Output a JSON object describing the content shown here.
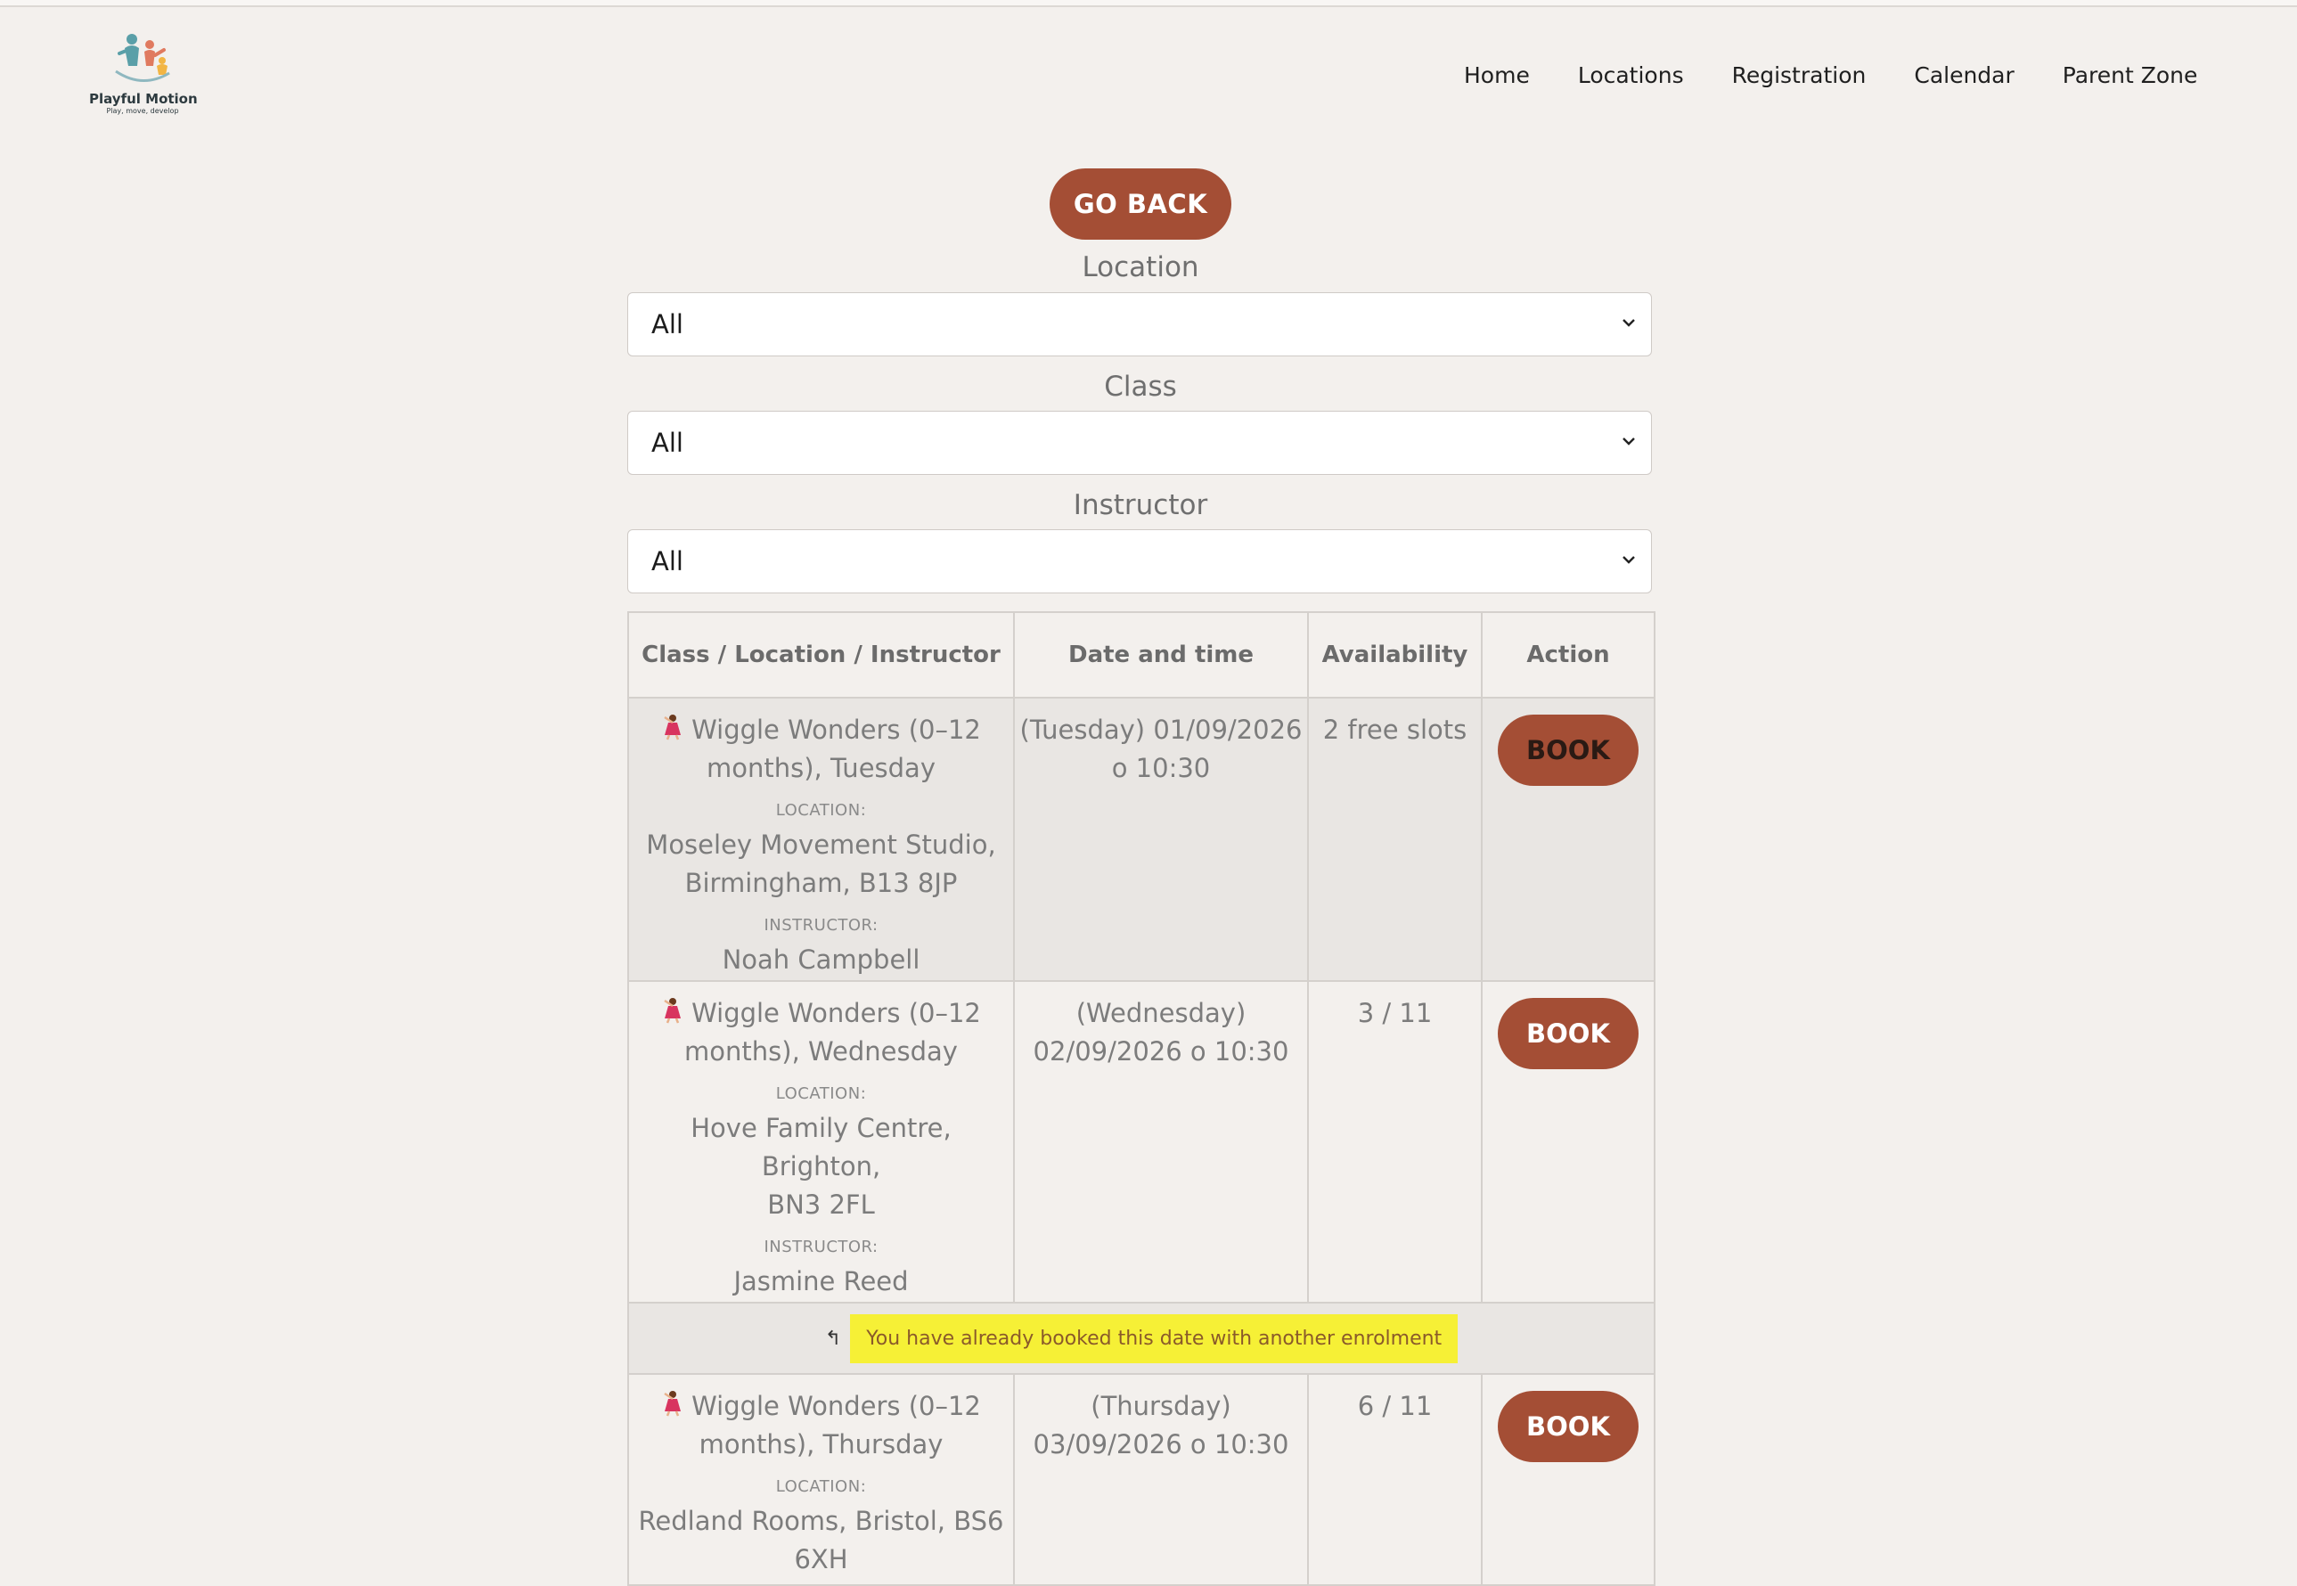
{
  "brand": {
    "name": "Playful Motion",
    "tagline": "Play, move, develop"
  },
  "nav": [
    "Home",
    "Locations",
    "Registration",
    "Calendar",
    "Parent Zone"
  ],
  "go_back": "GO BACK",
  "filters": {
    "location": {
      "label": "Location",
      "value": "All"
    },
    "class": {
      "label": "Class",
      "value": "All"
    },
    "instructor": {
      "label": "Instructor",
      "value": "All"
    }
  },
  "table": {
    "headers": [
      "Class / Location / Instructor",
      "Date and time",
      "Availability",
      "Action"
    ],
    "location_caption": "LOCATION:",
    "instructor_caption": "INSTRUCTOR:",
    "rows": [
      {
        "class_line1": "Wiggle Wonders (0–12",
        "class_line2": "months), Tuesday",
        "location_line1": "Moseley Movement Studio,",
        "location_line2": "Birmingham, B13 8JP",
        "instructor": "Noah Campbell",
        "date_line1": "(Tuesday) 01/09/2026",
        "date_line2": "o 10:30",
        "availability": "2 free slots",
        "action": "BOOK"
      },
      {
        "class_line1": "Wiggle Wonders (0–12",
        "class_line2": "months), Wednesday",
        "location_line1": "Hove Family Centre, Brighton,",
        "location_line2": "BN3 2FL",
        "instructor": "Jasmine Reed",
        "date_line1": "(Wednesday)",
        "date_line2": "02/09/2026 o 10:30",
        "availability": "3 / 11",
        "action": "BOOK"
      },
      {
        "class_line1": "Wiggle Wonders (0–12",
        "class_line2": "months), Thursday",
        "location_line1": "Redland Rooms, Bristol, BS6",
        "location_line2": "6XH",
        "date_line1": "(Thursday)",
        "date_line2": "03/09/2026 o 10:30",
        "availability": "6 / 11",
        "action": "BOOK"
      }
    ],
    "notice": "You have already booked this date with another enrolment"
  },
  "colors": {
    "accent": "#a44e35",
    "background": "#f3f0ed",
    "highlight": "#f6f036"
  }
}
